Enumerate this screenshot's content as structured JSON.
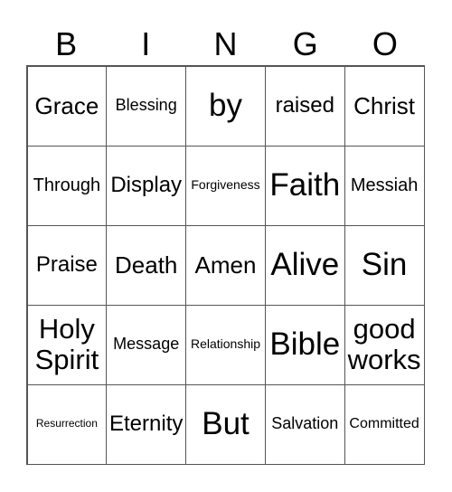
{
  "header": [
    "B",
    "I",
    "N",
    "G",
    "O"
  ],
  "cells": [
    [
      "Grace",
      "Blessing",
      "by",
      "raised",
      "Christ"
    ],
    [
      "Through",
      "Display",
      "Forgiveness",
      "Faith",
      "Messiah"
    ],
    [
      "Praise",
      "Death",
      "Amen",
      "Alive",
      "Sin"
    ],
    [
      "Holy Spirit",
      "Message",
      "Relationship",
      "Bible",
      "good works"
    ],
    [
      "Resurrection",
      "Eternity",
      "But",
      "Salvation",
      "Committed"
    ]
  ]
}
